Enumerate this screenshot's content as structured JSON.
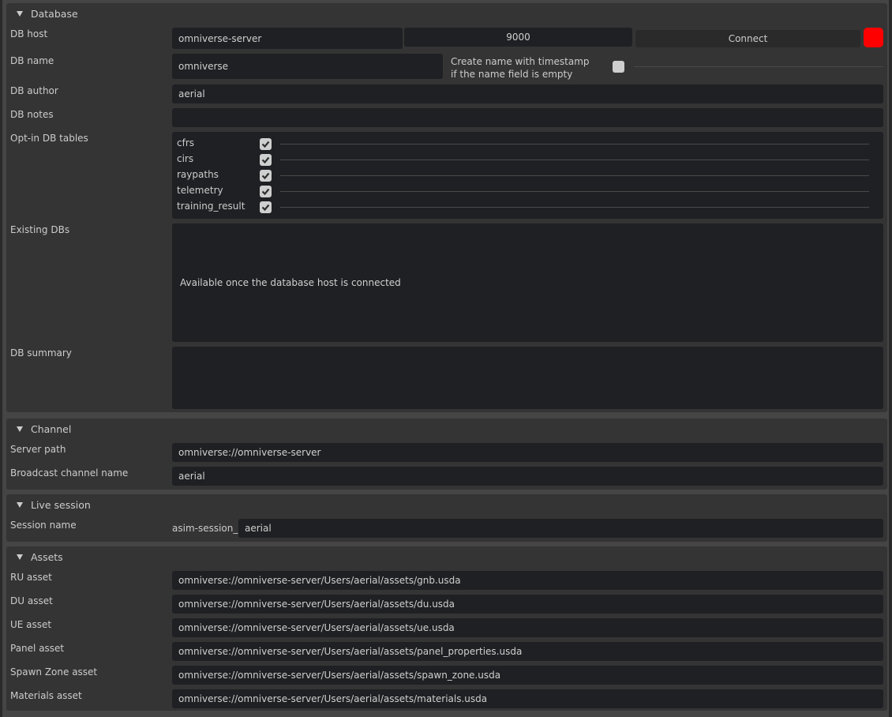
{
  "database": {
    "title": "Database",
    "host_label": "DB host",
    "host_value": "omniverse-server",
    "port_value": "9000",
    "connect_label": "Connect",
    "status_color": "#ff0000",
    "name_label": "DB name",
    "name_value": "omniverse",
    "timestamp_label_line1": "Create name with timestamp",
    "timestamp_label_line2": "if the name field is empty",
    "timestamp_checked": false,
    "author_label": "DB author",
    "author_value": "aerial",
    "notes_label": "DB notes",
    "notes_value": "",
    "tables_label": "Opt-in DB tables",
    "tables": [
      {
        "name": "cfrs",
        "checked": true
      },
      {
        "name": "cirs",
        "checked": true
      },
      {
        "name": "raypaths",
        "checked": true
      },
      {
        "name": "telemetry",
        "checked": true
      },
      {
        "name": "training_result",
        "checked": true
      }
    ],
    "existing_label": "Existing DBs",
    "existing_placeholder": "Available once the database host is connected",
    "summary_label": "DB summary",
    "summary_value": ""
  },
  "channel": {
    "title": "Channel",
    "server_path_label": "Server path",
    "server_path_value": "omniverse://omniverse-server",
    "broadcast_label": "Broadcast channel name",
    "broadcast_value": "aerial"
  },
  "live_session": {
    "title": "Live session",
    "session_label": "Session name",
    "session_prefix": "asim-session_",
    "session_value": "aerial"
  },
  "assets": {
    "title": "Assets",
    "items": [
      {
        "label": "RU asset",
        "value": "omniverse://omniverse-server/Users/aerial/assets/gnb.usda"
      },
      {
        "label": "DU asset",
        "value": "omniverse://omniverse-server/Users/aerial/assets/du.usda"
      },
      {
        "label": "UE asset",
        "value": "omniverse://omniverse-server/Users/aerial/assets/ue.usda"
      },
      {
        "label": "Panel asset",
        "value": "omniverse://omniverse-server/Users/aerial/assets/panel_properties.usda"
      },
      {
        "label": "Spawn Zone asset",
        "value": "omniverse://omniverse-server/Users/aerial/assets/spawn_zone.usda"
      },
      {
        "label": "Materials asset",
        "value": "omniverse://omniverse-server/Users/aerial/assets/materials.usda"
      }
    ]
  }
}
